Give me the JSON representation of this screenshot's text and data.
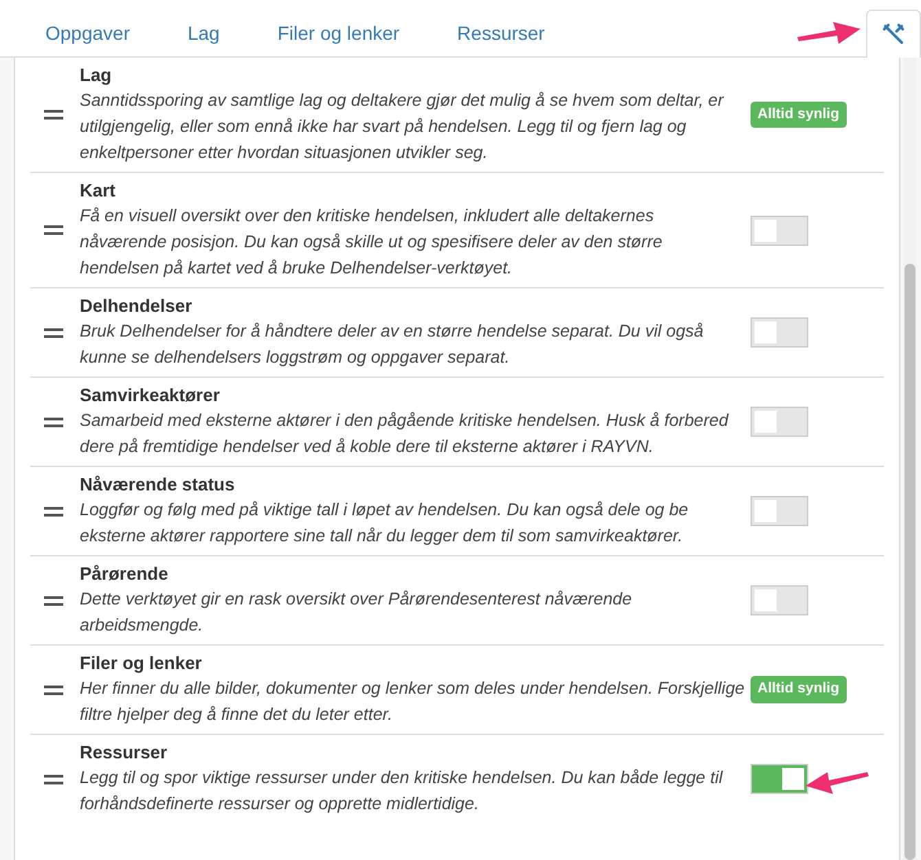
{
  "tabs": [
    {
      "kind": "text",
      "label": "Oppgaver",
      "selected": false
    },
    {
      "kind": "text",
      "label": "Lag",
      "selected": false
    },
    {
      "kind": "text",
      "label": "Filer og lenker",
      "selected": false
    },
    {
      "kind": "text",
      "label": "Ressurser",
      "selected": false
    },
    {
      "kind": "icon",
      "selected": true
    }
  ],
  "tools": [
    {
      "title": "Lag",
      "description": "Sanntidssporing av samtlige lag og deltakere gjør det mulig å se hvem som deltar, er utilgjengelig, eller som ennå ikke har svart på hendelsen. Legg til og fjern lag og enkeltpersoner etter hvordan situasjonen utvikler seg.",
      "kind": "badge",
      "badge": "Alltid synlig"
    },
    {
      "title": "Kart",
      "description": "Få en visuell oversikt over den kritiske hendelsen, inkludert alle deltakernes nåværende posisjon. Du kan også skille ut og spesifisere deler av den større hendelsen på kartet ved å bruke Delhendelser-verktøyet.",
      "kind": "toggle",
      "on": false
    },
    {
      "title": "Delhendelser",
      "description": "Bruk Delhendelser for å håndtere deler av en større hendelse separat. Du vil også kunne se delhendelsers loggstrøm og oppgaver separat.",
      "kind": "toggle",
      "on": false
    },
    {
      "title": "Samvirkeaktører",
      "description": "Samarbeid med eksterne aktører i den pågående kritiske hendelsen. Husk å forbered dere på fremtidige hendelser ved å koble dere til eksterne aktører i RAYVN.",
      "kind": "toggle",
      "on": false
    },
    {
      "title": "Nåværende status",
      "description": "Loggfør og følg med på viktige tall i løpet av hendelsen. Du kan også dele og be eksterne aktører rapportere sine tall når du legger dem til som samvirkeaktører.",
      "kind": "toggle",
      "on": false
    },
    {
      "title": "Pårørende",
      "description": "Dette verktøyet gir en rask oversikt over Pårørendesenterest nåværende arbeidsmengde.",
      "kind": "toggle",
      "on": false
    },
    {
      "title": "Filer og lenker",
      "description": "Her finner du alle bilder, dokumenter og lenker som deles under hendelsen. Forskjellige filtre hjelper deg å finne det du leter etter.",
      "kind": "badge",
      "badge": "Alltid synlig"
    },
    {
      "title": "Ressurser",
      "description": "Legg til og spor viktige ressurser under den kritiske hendelsen. Du kan både legge til forhåndsdefinerte ressurser og opprette midlertidige.",
      "kind": "toggle",
      "on": true
    }
  ]
}
